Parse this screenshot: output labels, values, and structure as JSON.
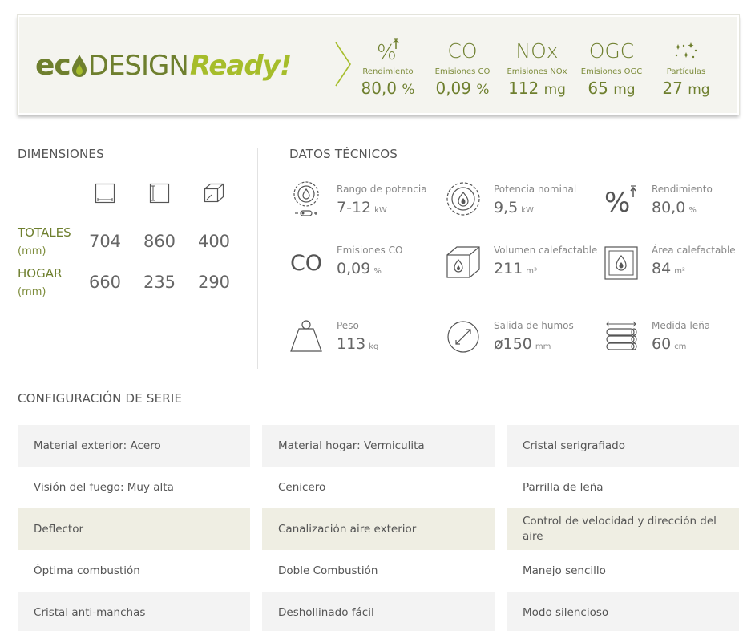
{
  "eco_banner": {
    "logo": {
      "eco": "ec",
      "design": "DESIGN",
      "ready": "Ready!"
    },
    "stats": [
      {
        "symbol": "%",
        "label": "Rendimiento",
        "value": "80,0",
        "unit": "%",
        "icon": "percent-up-icon"
      },
      {
        "symbol": "CO",
        "label": "Emisiones CO",
        "value": "0,09",
        "unit": "%",
        "icon": ""
      },
      {
        "symbol": "NOx",
        "label": "Emisiones NOx",
        "value": "112",
        "unit": "mg",
        "icon": ""
      },
      {
        "symbol": "OGC",
        "label": "Emisiones OGC",
        "value": "65",
        "unit": "mg",
        "icon": ""
      },
      {
        "symbol": "",
        "label": "Partículas",
        "value": "27",
        "unit": "mg",
        "icon": "particles-icon"
      }
    ]
  },
  "dimensions": {
    "title": "DIMENSIONES",
    "columns": [
      "width-icon",
      "height-icon",
      "depth-icon"
    ],
    "rows": [
      {
        "label": "TOTALES",
        "unit": "(mm)",
        "values": [
          "704",
          "860",
          "400"
        ]
      },
      {
        "label": "HOGAR",
        "unit": "(mm)",
        "values": [
          "660",
          "235",
          "290"
        ]
      }
    ]
  },
  "tech": {
    "title": "DATOS TÉCNICOS",
    "items": [
      {
        "icon": "power-range-icon",
        "label": "Rango de potencia",
        "value": "7-12",
        "unit": "kW"
      },
      {
        "icon": "nominal-power-icon",
        "label": "Potencia nominal",
        "value": "9,5",
        "unit": "kW"
      },
      {
        "icon": "efficiency-icon",
        "label": "Rendimiento",
        "value": "80,0",
        "unit": "%"
      },
      {
        "icon": "co-icon",
        "label": "Emisiones CO",
        "value": "0,09",
        "unit": "%",
        "symbol": "CO"
      },
      {
        "icon": "heated-volume-icon",
        "label": "Volumen calefactable",
        "value": "211",
        "unit": "m³"
      },
      {
        "icon": "heated-area-icon",
        "label": "Área calefactable",
        "value": "84",
        "unit": "m²"
      },
      {
        "icon": "weight-icon",
        "label": "Peso",
        "value": "113",
        "unit": "kg"
      },
      {
        "icon": "flue-outlet-icon",
        "label": "Salida de humos",
        "value": "ø150",
        "unit": "mm"
      },
      {
        "icon": "log-size-icon",
        "label": "Medida leña",
        "value": "60",
        "unit": "cm"
      }
    ]
  },
  "config": {
    "title": "CONFIGURACIÓN DE SERIE",
    "items": [
      "Material exterior: Acero",
      "Material hogar: Vermiculita",
      "Cristal serigrafiado",
      "Visión del fuego: Muy alta",
      "Cenicero",
      "Parrilla de leña",
      "Deflector",
      "Canalización aire exterior",
      "Control de velocidad y dirección del aire",
      "Óptima combustión",
      "Doble Combustión",
      "Manejo sencillo",
      "Cristal anti-manchas",
      "Deshollinado fácil",
      "Modo silencioso"
    ]
  },
  "colors": {
    "brand_dark": "#6e7f2e",
    "brand_light": "#a6bd2b",
    "banner_bg": "#f4f4ef"
  }
}
